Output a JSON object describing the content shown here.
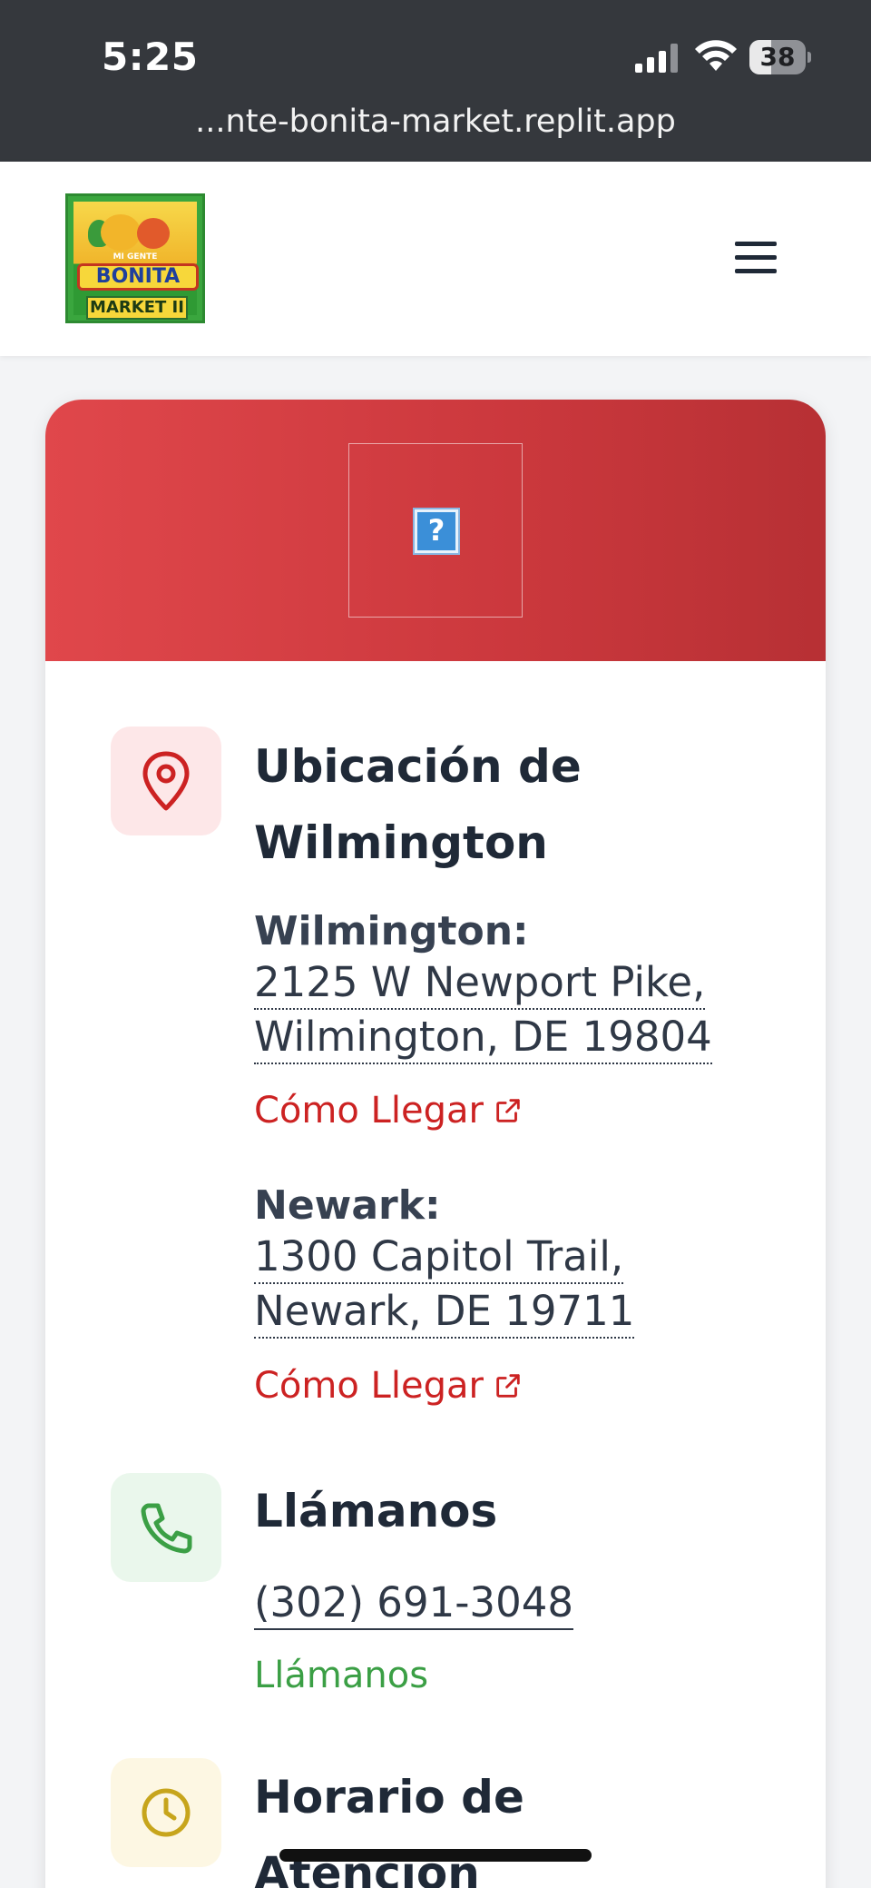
{
  "status_bar": {
    "time": "5:25",
    "battery_percent": 38
  },
  "browser": {
    "url": "...nte-bonita-market.replit.app"
  },
  "header": {
    "logo": {
      "line1": "MI GENTE",
      "line2": "BONITA",
      "line3": "MARKET II"
    }
  },
  "card": {
    "image_placeholder": "?",
    "location": {
      "title": "Ubicación de Wilmington",
      "stores": [
        {
          "label": "Wilmington:",
          "address_line1": "2125 W Newport Pike,",
          "address_line2": "Wilmington, DE 19804",
          "directions": "Cómo Llegar"
        },
        {
          "label": "Newark:",
          "address_line1": "1300 Capitol Trail,",
          "address_line2": "Newark, DE 19711",
          "directions": "Cómo Llegar"
        }
      ]
    },
    "call": {
      "title": "Llámanos",
      "phone": "(302) 691-3048",
      "link": "Llámanos"
    },
    "hours": {
      "title": "Horario de Atención"
    }
  },
  "colors": {
    "accent_red": "#cc2222",
    "card_header": "#d23f43",
    "accent_green": "#3b9f45",
    "clock_gold": "#c7a51c"
  }
}
